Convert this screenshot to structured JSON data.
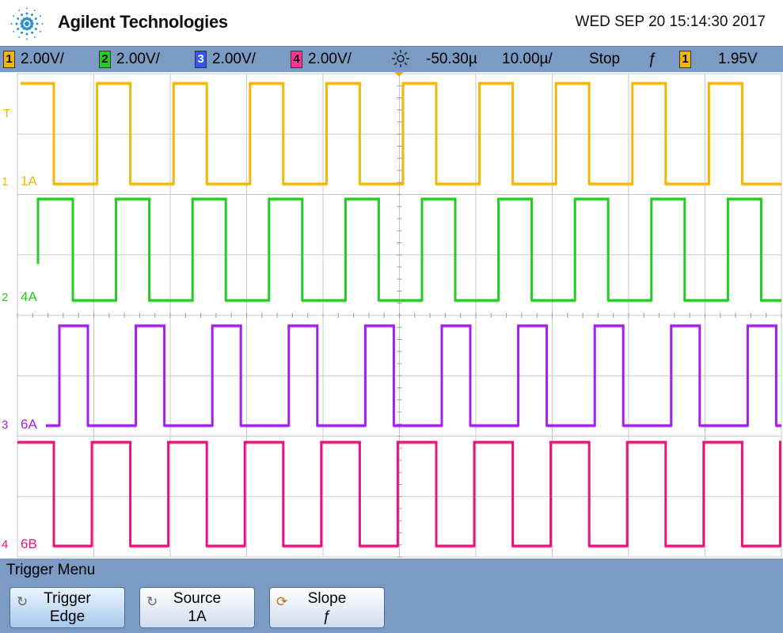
{
  "header": {
    "brand": "Agilent Technologies",
    "datetime": "WED SEP 20 15:14:30 2017"
  },
  "status": {
    "channels": [
      {
        "num": "1",
        "scale": "2.00V/",
        "color": "#f2b705"
      },
      {
        "num": "2",
        "scale": "2.00V/",
        "color": "#22cc22"
      },
      {
        "num": "3",
        "scale": "2.00V/",
        "color": "#3355ff"
      },
      {
        "num": "4",
        "scale": "2.00V/",
        "color": "#ff3399"
      }
    ],
    "time_ref_icon": "sun-icon",
    "delay": "-50.30µ",
    "timebase": "10.00µ/",
    "run_state": "Stop",
    "trigger_slope_symbol": "ƒ",
    "trigger_channel": "1",
    "trigger_level": "1.95V"
  },
  "display": {
    "trigger_marker": "T",
    "channels": [
      {
        "marker": "1",
        "label": "1A",
        "color": "#f2b705"
      },
      {
        "marker": "2",
        "label": "4A",
        "color": "#22cc22"
      },
      {
        "marker": "3",
        "label": "6A",
        "color": "#a020f0"
      },
      {
        "marker": "4",
        "label": "6B",
        "color": "#e5157a"
      }
    ],
    "colors": {
      "ch1": "#f2b705",
      "ch2": "#22cc22",
      "ch3": "#a020f0",
      "ch4": "#e5157a",
      "grid": "#c9c9c9",
      "gridDot": "#9a9a9a"
    }
  },
  "chart_data": {
    "type": "line",
    "timebase_per_div": "10.00µ",
    "divisions_x": 10,
    "series": [
      {
        "name": "1A",
        "values_x_div": [
          0.0,
          0.0,
          1.0,
          1.0,
          2.0,
          2.0,
          3.0,
          3.0,
          4.0,
          4.0,
          5.0,
          5.0,
          6.0,
          6.0,
          7.0,
          7.0,
          8.0,
          8.0,
          9.0,
          9.0,
          10.0
        ],
        "levels": [
          1,
          0,
          1,
          0,
          1,
          0,
          1,
          0,
          1,
          0,
          1,
          0,
          1,
          0,
          1,
          0,
          1,
          0,
          1,
          0,
          1
        ],
        "period_div": 1.0,
        "duty": 0.45
      },
      {
        "name": "4A",
        "period_div": 1.0,
        "duty": 0.45
      },
      {
        "name": "6A",
        "period_div": 1.0,
        "duty": 0.4
      },
      {
        "name": "6B",
        "period_div": 1.0,
        "duty": 0.55
      }
    ]
  },
  "menu": {
    "title": "Trigger Menu",
    "softkeys": [
      {
        "line1": "Trigger",
        "line2": "Edge",
        "icon": "rotate-icon"
      },
      {
        "line1": "Source",
        "line2": "1A",
        "icon": "rotate-icon"
      },
      {
        "line1": "Slope",
        "line2": "ƒ",
        "icon": "slope-icon"
      }
    ]
  }
}
